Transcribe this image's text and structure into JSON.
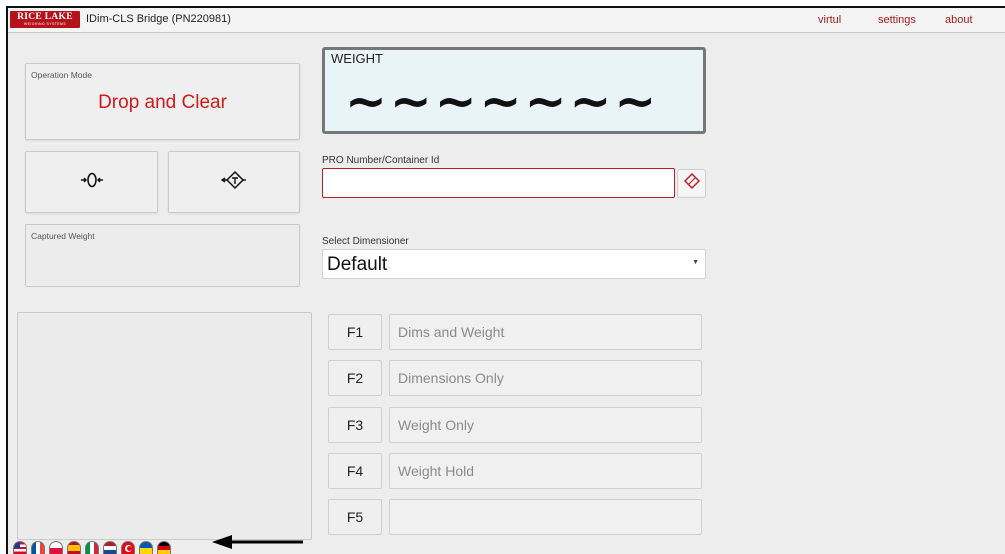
{
  "colors": {
    "brand": "#b5121b",
    "accent_red": "#d11a1a",
    "weight_bg": "#e9f4f8"
  },
  "header": {
    "logo_line1": "RICE LAKE",
    "logo_line2": "WEIGHING SYSTEMS",
    "title": "IDim-CLS Bridge (PN220981)",
    "links": [
      "virtul",
      "settings",
      "about"
    ]
  },
  "operation_mode": {
    "label": "Operation Mode",
    "value": "Drop and Clear"
  },
  "controls": {
    "zero_icon": "zero-icon",
    "tare_icon": "tare-icon"
  },
  "captured_weight": {
    "label": "Captured Weight",
    "value": ""
  },
  "weight": {
    "label": "WEIGHT",
    "value": "~~~~~~~"
  },
  "pro_number": {
    "label": "PRO Number/Container Id",
    "value": "",
    "placeholder": ""
  },
  "dimensioner": {
    "label": "Select Dimensioner",
    "selected": "Default"
  },
  "function_keys": [
    {
      "key": "F1",
      "label": "Dims and Weight"
    },
    {
      "key": "F2",
      "label": "Dimensions Only"
    },
    {
      "key": "F3",
      "label": "Weight Only"
    },
    {
      "key": "F4",
      "label": "Weight Hold"
    },
    {
      "key": "F5",
      "label": ""
    }
  ],
  "languages": [
    "us-flag-icon",
    "fr-flag-icon",
    "pl-flag-icon",
    "es-flag-icon",
    "it-flag-icon",
    "nl-flag-icon",
    "tr-flag-icon",
    "ua-flag-icon",
    "de-flag-icon"
  ]
}
